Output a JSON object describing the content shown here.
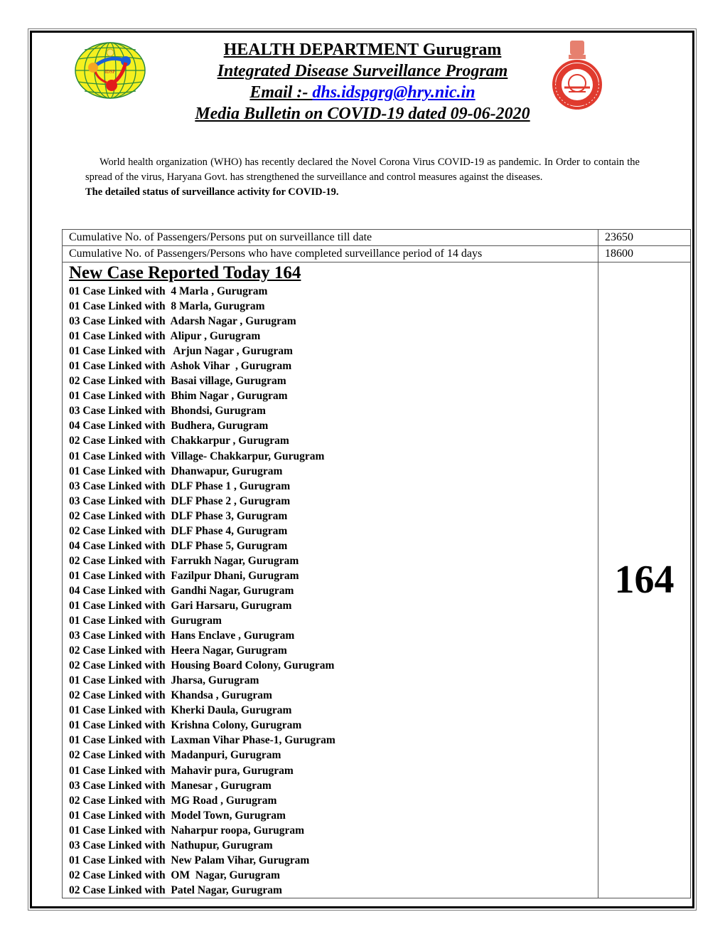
{
  "header": {
    "title": "HEALTH DEPARTMENT Gurugram",
    "program": "Integrated Disease Surveillance Program",
    "email_label": "Email :- ",
    "email": "dhs.idspgrg@hry.nic.in",
    "bulletin": "Media Bulletin on COVID-19 dated 09-06-2020",
    "left_logo_text": "IDSP",
    "right_logo_text": "GOVT. OF HARYANA"
  },
  "intro": {
    "paragraph": "World health organization (WHO) has recently declared the Novel Corona Virus COVID-19 as pandemic. In Order to contain the spread of the virus, Haryana Govt. has strengthened the surveillance and control measures against the diseases.",
    "status_heading": "The detailed status of surveillance activity for COVID-19."
  },
  "stats": [
    {
      "label": "Cumulative No. of Passengers/Persons put on surveillance till date",
      "value": "23650"
    },
    {
      "label": "Cumulative No. of Passengers/Persons who have completed surveillance period of 14 days",
      "value": "18600"
    }
  ],
  "new_cases": {
    "heading": "New Case Reported Today 164",
    "total": "164",
    "lines": [
      "01 Case Linked with  4 Marla , Gurugram",
      "01 Case Linked with  8 Marla, Gurugram",
      "03 Case Linked with  Adarsh Nagar , Gurugram",
      "01 Case Linked with  Alipur , Gurugram",
      "01 Case Linked with   Arjun Nagar , Gurugram",
      "01 Case Linked with  Ashok Vihar  , Gurugram",
      "02 Case Linked with  Basai village, Gurugram",
      "01 Case Linked with  Bhim Nagar , Gurugram",
      "03 Case Linked with  Bhondsi, Gurugram",
      "04 Case Linked with  Budhera, Gurugram",
      "02 Case Linked with  Chakkarpur , Gurugram",
      "01 Case Linked with  Village- Chakkarpur, Gurugram",
      "01 Case Linked with  Dhanwapur, Gurugram",
      "03 Case Linked with  DLF Phase 1 , Gurugram",
      "03 Case Linked with  DLF Phase 2 , Gurugram",
      "02 Case Linked with  DLF Phase 3, Gurugram",
      "02 Case Linked with  DLF Phase 4, Gurugram",
      "04 Case Linked with  DLF Phase 5, Gurugram",
      "02 Case Linked with  Farrukh Nagar, Gurugram",
      "01 Case Linked with  Fazilpur Dhani, Gurugram",
      "04 Case Linked with  Gandhi Nagar, Gurugram",
      "01 Case Linked with  Gari Harsaru, Gurugram",
      "01 Case Linked with  Gurugram",
      "03 Case Linked with  Hans Enclave , Gurugram",
      "02 Case Linked with  Heera Nagar, Gurugram",
      "02 Case Linked with  Housing Board Colony, Gurugram",
      "01 Case Linked with  Jharsa, Gurugram",
      "02 Case Linked with  Khandsa , Gurugram",
      "01 Case Linked with  Kherki Daula, Gurugram",
      "01 Case Linked with  Krishna Colony, Gurugram",
      "01 Case Linked with  Laxman Vihar Phase-1, Gurugram",
      "02 Case Linked with  Madanpuri, Gurugram",
      "01 Case Linked with  Mahavir pura, Gurugram",
      "03 Case Linked with  Manesar , Gurugram",
      "02 Case Linked with  MG Road , Gurugram",
      "01 Case Linked with  Model Town, Gurugram",
      "01 Case Linked with  Naharpur roopa, Gurugram",
      "03 Case Linked with  Nathupur, Gurugram",
      "01 Case Linked with  New Palam Vihar, Gurugram",
      "02 Case Linked with  OM  Nagar, Gurugram",
      "02 Case Linked with  Patel Nagar, Gurugram"
    ]
  },
  "colors": {
    "link": "#0000ee",
    "logo_yellow": "#f5f020",
    "logo_green": "#2e8b3a",
    "emblem_red": "#e03a2e"
  }
}
